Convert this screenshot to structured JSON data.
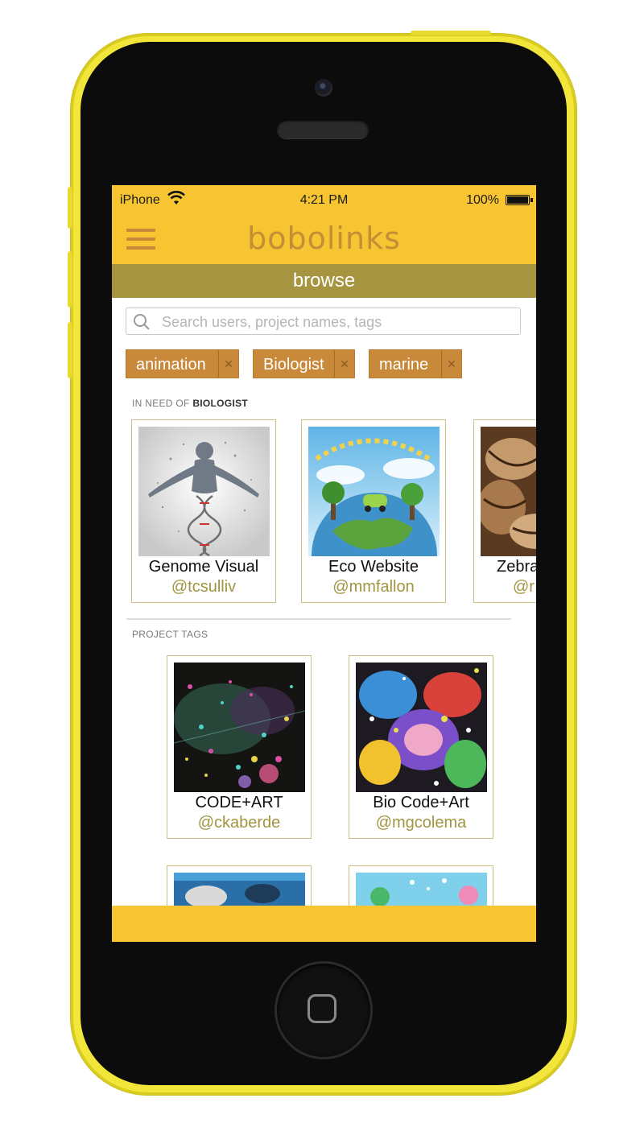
{
  "status_bar": {
    "carrier": "iPhone",
    "time": "4:21 PM",
    "battery": "100%"
  },
  "app": {
    "title": "bobolinks",
    "section": "browse"
  },
  "search": {
    "placeholder": "Search users, project names, tags"
  },
  "filter_chips": [
    {
      "label": "animation"
    },
    {
      "label": "Biologist"
    },
    {
      "label": "marine"
    }
  ],
  "need_section": {
    "prefix": "IN NEED OF",
    "role": "BIOLOGIST",
    "cards": [
      {
        "title": "Genome Visual",
        "user": "@tcsulliv"
      },
      {
        "title": "Eco Website",
        "user": "@mmfallon"
      },
      {
        "title": "Zebra",
        "user": "@r"
      }
    ]
  },
  "tags_section": {
    "label": "PROJECT TAGS",
    "cards": [
      {
        "title": "CODE+ART",
        "user": "@ckaberde"
      },
      {
        "title": "Bio Code+Art",
        "user": "@mgcolema"
      }
    ]
  },
  "colors": {
    "brand_yellow": "#f7c531",
    "accent_orange": "#c8893a",
    "olive": "#a69440"
  }
}
